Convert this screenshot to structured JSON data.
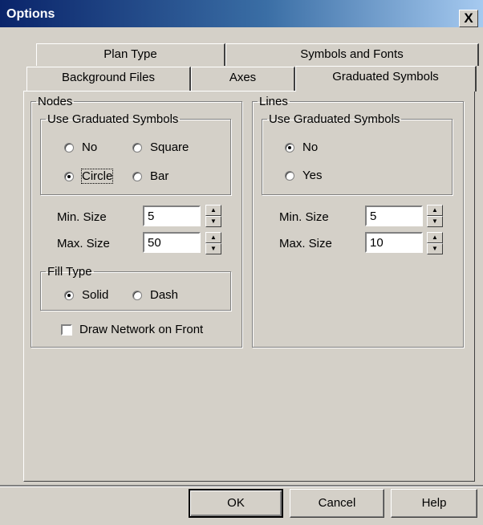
{
  "window": {
    "title": "Options",
    "close_glyph": "X"
  },
  "tabs_back_row": [
    "Plan Type",
    "Symbols and Fonts"
  ],
  "tabs_front_row": [
    "Background Files",
    "Axes",
    "Graduated Symbols"
  ],
  "active_tab": "Graduated Symbols",
  "nodes": {
    "legend": "Nodes",
    "use_graduated": {
      "legend": "Use Graduated Symbols",
      "options": [
        "No",
        "Square",
        "Circle",
        "Bar"
      ],
      "selected": "Circle"
    },
    "min_size_label": "Min. Size",
    "min_size_value": "5",
    "max_size_label": "Max. Size",
    "max_size_value": "50",
    "fill_type": {
      "legend": "Fill Type",
      "options": [
        "Solid",
        "Dash"
      ],
      "selected": "Solid"
    },
    "draw_network_label": "Draw Network on Front",
    "draw_network_checked": false
  },
  "lines": {
    "legend": "Lines",
    "use_graduated": {
      "legend": "Use Graduated Symbols",
      "options": [
        "No",
        "Yes"
      ],
      "selected": "No"
    },
    "min_size_label": "Min. Size",
    "min_size_value": "5",
    "max_size_label": "Max. Size",
    "max_size_value": "10"
  },
  "buttons": {
    "ok": "OK",
    "cancel": "Cancel",
    "help": "Help"
  }
}
